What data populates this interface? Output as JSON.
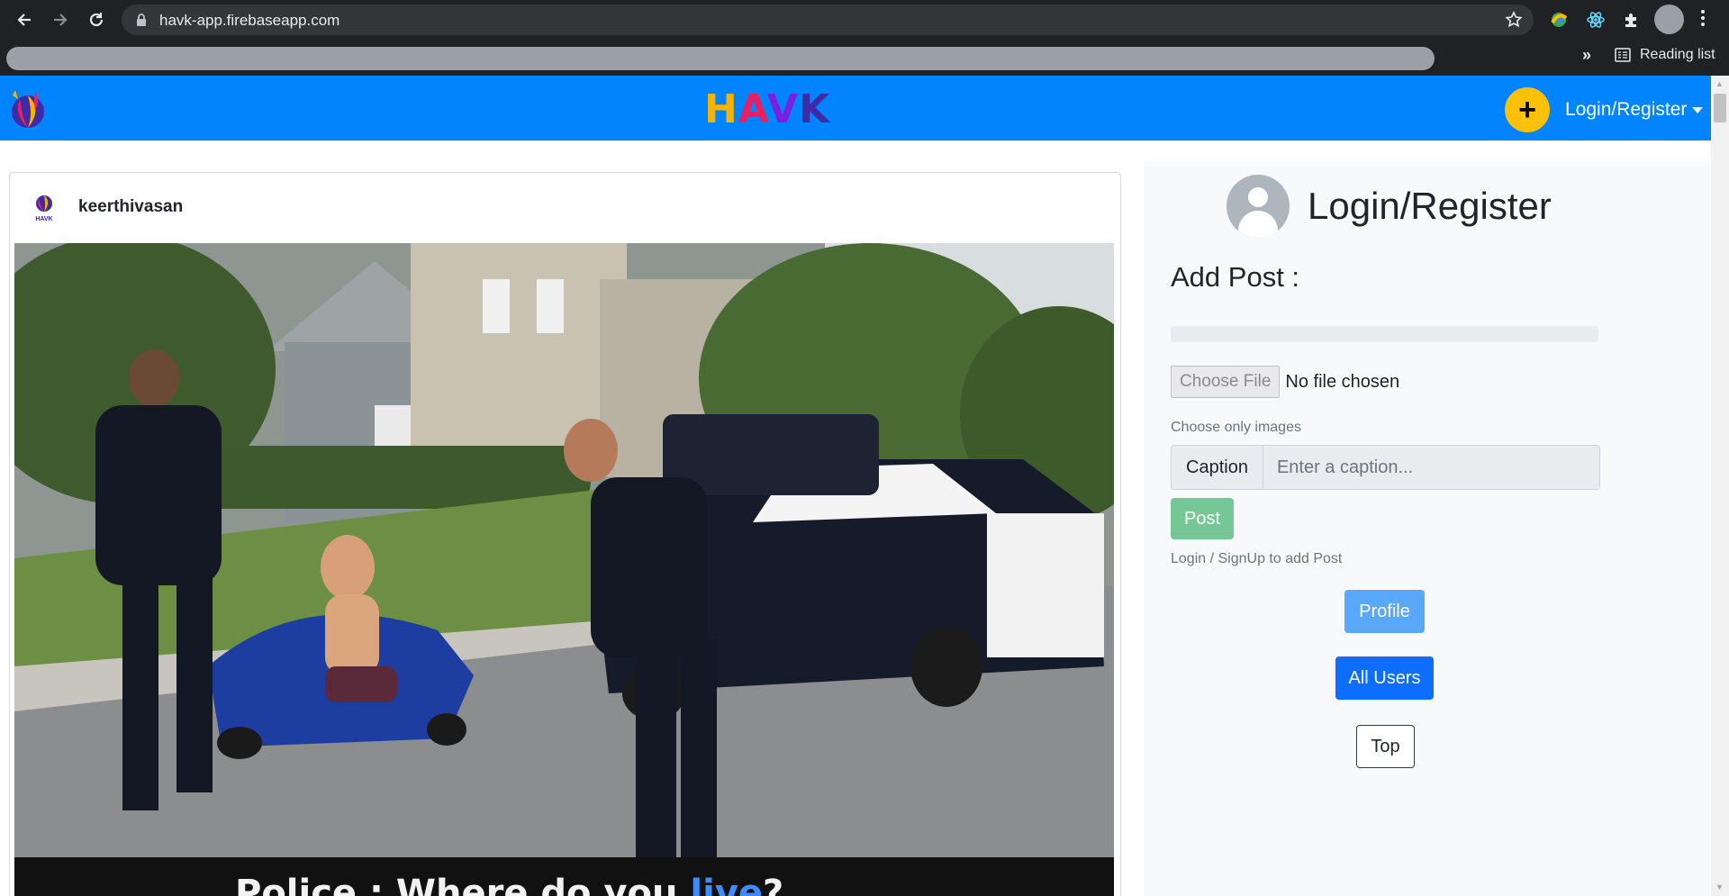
{
  "browser": {
    "url": "havk-app.firebaseapp.com",
    "reading_list_label": "Reading list",
    "overflow_label": "»"
  },
  "navbar": {
    "brand_letters": [
      "H",
      "A",
      "V",
      "K"
    ],
    "add_button_label": "+",
    "login_dropdown_label": "Login/Register",
    "color": "#0384ff"
  },
  "post": {
    "username": "keerthivasan",
    "mini_logo_text": "HAVK",
    "image_caption_before": "Police : Where do you ",
    "image_caption_highlight": "live",
    "image_caption_after": "?"
  },
  "sidebar": {
    "title": "Login/Register",
    "add_post_heading": "Add Post :",
    "upload_progress": 0,
    "choose_file_label": "Choose File",
    "no_file_label": "No file chosen",
    "file_hint": "Choose only images",
    "caption_label": "Caption",
    "caption_placeholder": "Enter a caption...",
    "post_button_label": "Post",
    "login_hint": "Login / SignUp to add Post",
    "profile_button_label": "Profile",
    "all_users_button_label": "All Users",
    "top_button_label": "Top"
  }
}
